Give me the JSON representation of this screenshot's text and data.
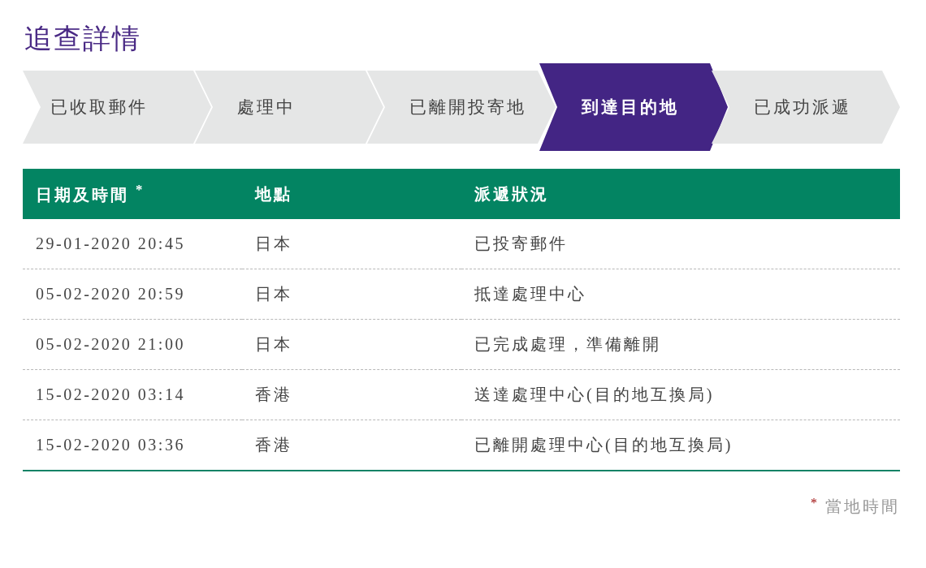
{
  "title": "追查詳情",
  "steps": [
    {
      "label": "已收取郵件",
      "selected": false
    },
    {
      "label": "處理中",
      "selected": false
    },
    {
      "label": "已離開投寄地",
      "selected": false
    },
    {
      "label": "到達目的地",
      "selected": true
    },
    {
      "label": "已成功派遞",
      "selected": false
    }
  ],
  "table": {
    "columns": [
      "日期及時間 $^{*}$",
      "地點",
      "派遞狀況"
    ],
    "rows": [
      [
        "29-01-2020 20:45",
        "日本",
        "已投寄郵件"
      ],
      [
        "05-02-2020 20:59",
        "日本",
        "抵達處理中心"
      ],
      [
        "05-02-2020 21:00",
        "日本",
        "已完成處理，準備離開"
      ],
      [
        "15-02-2020 03:14",
        "香港",
        "送達處理中心(目的地互換局)"
      ],
      [
        "15-02-2020 03:36",
        "香港",
        "已離開處理中心(目的地互換局)"
      ]
    ]
  },
  "footnote": {
    "mark": "*",
    "text": "當地時間"
  }
}
